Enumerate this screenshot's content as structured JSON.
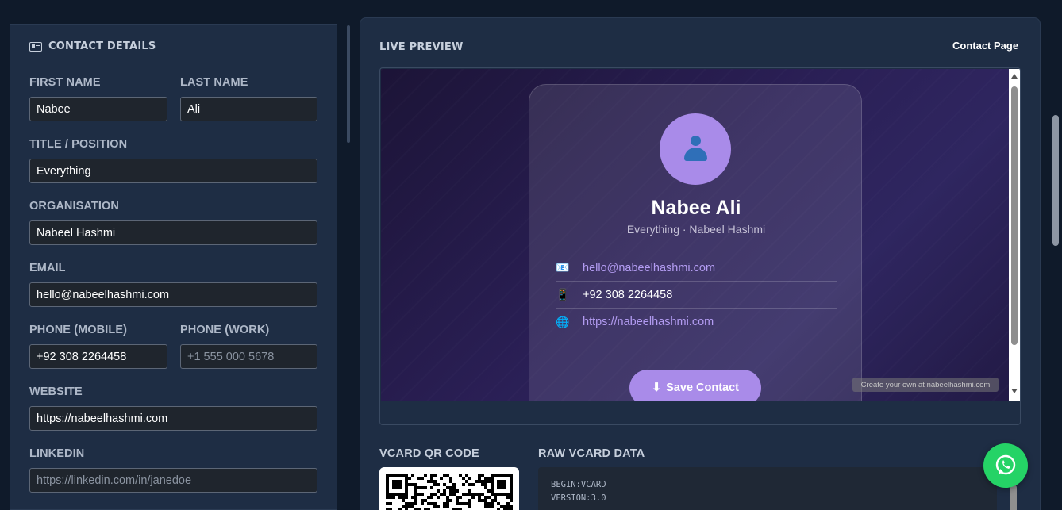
{
  "contact_details": {
    "heading": "CONTACT DETAILS",
    "first_name": {
      "label": "FIRST NAME",
      "value": "Nabee"
    },
    "last_name": {
      "label": "LAST NAME",
      "value": "Ali"
    },
    "title": {
      "label": "TITLE / POSITION",
      "value": "Everything"
    },
    "organisation": {
      "label": "ORGANISATION",
      "value": "Nabeel Hashmi"
    },
    "email": {
      "label": "EMAIL",
      "value": "hello@nabeelhashmi.com"
    },
    "phone_mobile": {
      "label": "PHONE (MOBILE)",
      "value": "+92 308 2264458"
    },
    "phone_work": {
      "label": "PHONE (WORK)",
      "value": "",
      "placeholder": "+1 555 000 5678"
    },
    "website": {
      "label": "WEBSITE",
      "value": "https://nabeelhashmi.com"
    },
    "linkedin": {
      "label": "LINKEDIN",
      "value": "",
      "placeholder": "https://linkedin.com/in/janedoe"
    }
  },
  "preview": {
    "heading": "LIVE PREVIEW",
    "tab": "Contact Page",
    "card": {
      "name": "Nabee Ali",
      "subtitle": "Everything · Nabeel Hashmi",
      "rows": [
        {
          "icon": "📧",
          "icon_name": "email-icon",
          "text": "hello@nabeelhashmi.com"
        },
        {
          "icon": "📱",
          "icon_name": "mobile-phone-icon",
          "text": "+92 308 2264458"
        },
        {
          "icon": "🌐",
          "icon_name": "globe-icon",
          "text": "https://nabeelhashmi.com"
        }
      ],
      "save_button": "Save Contact",
      "save_icon": "⬇",
      "watermark": "Create your own at nabeelhashmi.com"
    }
  },
  "qr": {
    "heading": "VCARD QR CODE"
  },
  "raw": {
    "heading": "RAW VCARD DATA",
    "lines": [
      "BEGIN:VCARD",
      "VERSION:3.0"
    ]
  },
  "colors": {
    "accent": "#a98be9",
    "link": "#b39cf2",
    "whatsapp": "#25d366",
    "panel": "#1e2d44",
    "background": "#0f1a2a"
  }
}
